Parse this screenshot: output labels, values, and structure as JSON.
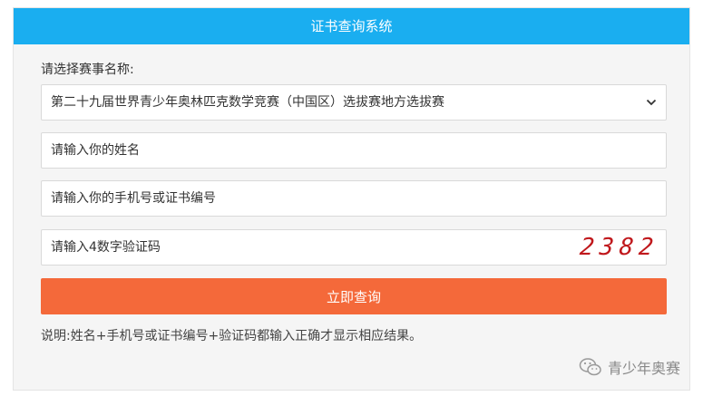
{
  "header": {
    "title": "证书查询系统"
  },
  "form": {
    "select_label": "请选择赛事名称:",
    "event_select": {
      "value": "第二十九届世界青少年奥林匹克数学竞赛（中国区）选拔赛地方选拔赛"
    },
    "name_input": {
      "placeholder": "请输入你的姓名"
    },
    "phone_input": {
      "placeholder": "请输入你的手机号或证书编号"
    },
    "captcha_input": {
      "placeholder": "请输入4数字验证码"
    },
    "captcha_code": "2382",
    "submit_label": "立即查询",
    "note": "说明:姓名+手机号或证书编号+验证码都输入正确才显示相应结果。"
  },
  "watermark": {
    "text": "青少年奥赛",
    "icon": "wechat-icon"
  },
  "colors": {
    "header_bg": "#1aaef0",
    "button_bg": "#f4693a",
    "captcha": "#c0181c",
    "panel_bg": "#f5f5f5"
  }
}
